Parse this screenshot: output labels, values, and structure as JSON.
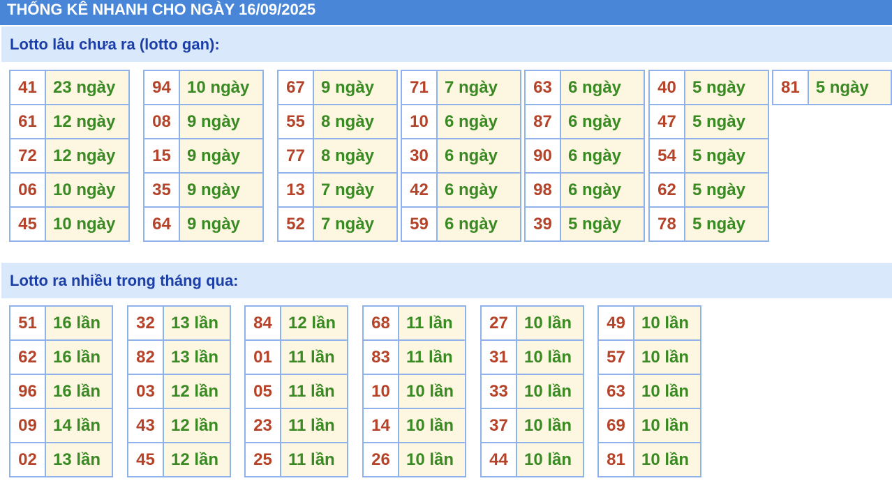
{
  "title": "THỐNG KÊ NHANH CHO NGÀY 16/09/2025",
  "lotto_gan": {
    "heading": "Lotto lâu chưa ra (lotto gan):",
    "columns": [
      [
        {
          "num": "41",
          "val": "23 ngày"
        },
        {
          "num": "61",
          "val": "12 ngày"
        },
        {
          "num": "72",
          "val": "12 ngày"
        },
        {
          "num": "06",
          "val": "10 ngày"
        },
        {
          "num": "45",
          "val": "10 ngày"
        }
      ],
      [
        {
          "num": "94",
          "val": "10 ngày"
        },
        {
          "num": "08",
          "val": "9 ngày"
        },
        {
          "num": "15",
          "val": "9 ngày"
        },
        {
          "num": "35",
          "val": "9 ngày"
        },
        {
          "num": "64",
          "val": "9 ngày"
        }
      ],
      [
        {
          "num": "67",
          "val": "9 ngày"
        },
        {
          "num": "55",
          "val": "8 ngày"
        },
        {
          "num": "77",
          "val": "8 ngày"
        },
        {
          "num": "13",
          "val": "7 ngày"
        },
        {
          "num": "52",
          "val": "7 ngày"
        }
      ],
      [
        {
          "num": "71",
          "val": "7 ngày"
        },
        {
          "num": "10",
          "val": "6 ngày"
        },
        {
          "num": "30",
          "val": "6 ngày"
        },
        {
          "num": "42",
          "val": "6 ngày"
        },
        {
          "num": "59",
          "val": "6 ngày"
        }
      ],
      [
        {
          "num": "63",
          "val": "6 ngày"
        },
        {
          "num": "87",
          "val": "6 ngày"
        },
        {
          "num": "90",
          "val": "6 ngày"
        },
        {
          "num": "98",
          "val": "6 ngày"
        },
        {
          "num": "39",
          "val": "5 ngày"
        }
      ],
      [
        {
          "num": "40",
          "val": "5 ngày"
        },
        {
          "num": "47",
          "val": "5 ngày"
        },
        {
          "num": "54",
          "val": "5 ngày"
        },
        {
          "num": "62",
          "val": "5 ngày"
        },
        {
          "num": "78",
          "val": "5 ngày"
        }
      ],
      [
        {
          "num": "81",
          "val": "5 ngày"
        }
      ]
    ]
  },
  "lotto_nhieu": {
    "heading": "Lotto ra nhiều trong tháng qua:",
    "columns": [
      [
        {
          "num": "51",
          "val": "16 lần"
        },
        {
          "num": "62",
          "val": "16 lần"
        },
        {
          "num": "96",
          "val": "16 lần"
        },
        {
          "num": "09",
          "val": "14 lần"
        },
        {
          "num": "02",
          "val": "13 lần"
        }
      ],
      [
        {
          "num": "32",
          "val": "13 lần"
        },
        {
          "num": "82",
          "val": "13 lần"
        },
        {
          "num": "03",
          "val": "12 lần"
        },
        {
          "num": "43",
          "val": "12 lần"
        },
        {
          "num": "45",
          "val": "12 lần"
        }
      ],
      [
        {
          "num": "84",
          "val": "12 lần"
        },
        {
          "num": "01",
          "val": "11 lần"
        },
        {
          "num": "05",
          "val": "11 lần"
        },
        {
          "num": "23",
          "val": "11 lần"
        },
        {
          "num": "25",
          "val": "11 lần"
        }
      ],
      [
        {
          "num": "68",
          "val": "11 lần"
        },
        {
          "num": "83",
          "val": "11 lần"
        },
        {
          "num": "10",
          "val": "10 lần"
        },
        {
          "num": "14",
          "val": "10 lần"
        },
        {
          "num": "26",
          "val": "10 lần"
        }
      ],
      [
        {
          "num": "27",
          "val": "10 lần"
        },
        {
          "num": "31",
          "val": "10 lần"
        },
        {
          "num": "33",
          "val": "10 lần"
        },
        {
          "num": "37",
          "val": "10 lần"
        },
        {
          "num": "44",
          "val": "10 lần"
        }
      ],
      [
        {
          "num": "49",
          "val": "10 lần"
        },
        {
          "num": "57",
          "val": "10 lần"
        },
        {
          "num": "63",
          "val": "10 lần"
        },
        {
          "num": "69",
          "val": "10 lần"
        },
        {
          "num": "81",
          "val": "10 lần"
        }
      ]
    ]
  }
}
